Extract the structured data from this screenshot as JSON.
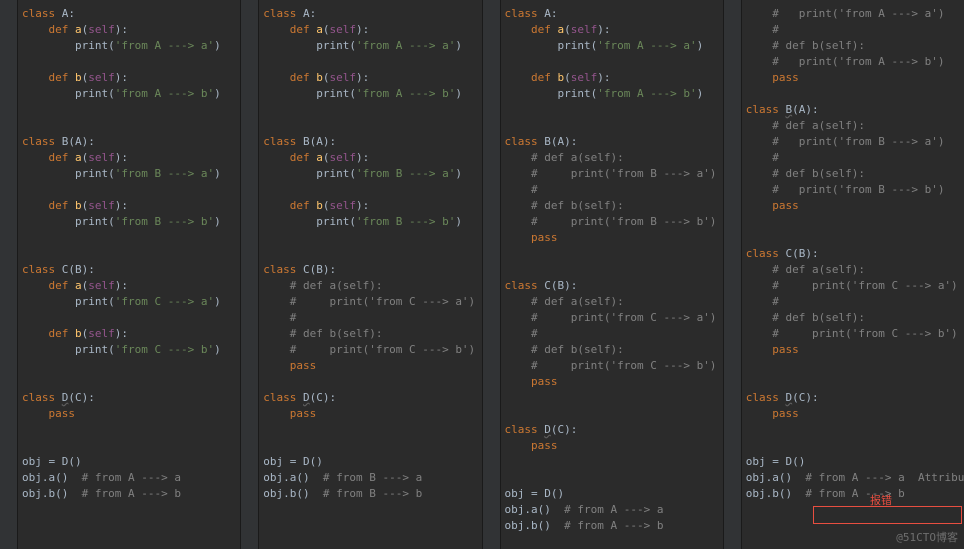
{
  "panes": {
    "p1": {
      "classA": {
        "decl": "class",
        "name": "A",
        "colon": ":",
        "a": {
          "kw": "def",
          "name": "a",
          "args": "(self):",
          "body": "print('from A ---> a')"
        },
        "b": {
          "kw": "def",
          "name": "b",
          "args": "(self):",
          "body": "print('from A ---> b')"
        }
      },
      "classB": {
        "decl": "class",
        "name": "B",
        "base": "(A)",
        "colon": ":",
        "a": {
          "kw": "def",
          "name": "a",
          "args": "(self):",
          "body": "print('from B ---> a')"
        },
        "b": {
          "kw": "def",
          "name": "b",
          "args": "(self):",
          "body": "print('from B ---> b')"
        }
      },
      "classC": {
        "decl": "class",
        "name": "C",
        "base": "(B)",
        "colon": ":",
        "a": {
          "kw": "def",
          "name": "a",
          "args": "(self):",
          "body": "print('from C ---> a')"
        },
        "b": {
          "kw": "def",
          "name": "b",
          "args": "(self):",
          "body": "print('from C ---> b')"
        }
      },
      "classD": {
        "decl": "class",
        "name": "D",
        "base": "(C)",
        "colon": ":",
        "pass": "pass"
      },
      "exec": {
        "assign": "obj = D()",
        "l1": "obj.a()",
        "c1": "# from A ---> a",
        "l2": "obj.b()",
        "c2": "# from A ---> b"
      }
    },
    "p2": {
      "classA": {
        "decl": "class",
        "name": "A",
        "colon": ":",
        "a": {
          "kw": "def",
          "name": "a",
          "args": "(self):",
          "body": "print('from A ---> a')"
        },
        "b": {
          "kw": "def",
          "name": "b",
          "args": "(self):",
          "body": "print('from A ---> b')"
        }
      },
      "classB": {
        "decl": "class",
        "name": "B",
        "base": "(A)",
        "colon": ":",
        "a": {
          "kw": "def",
          "name": "a",
          "args": "(self):",
          "body": "print('from B ---> a')"
        },
        "b": {
          "kw": "def",
          "name": "b",
          "args": "(self):",
          "body": "print('from B ---> b')"
        }
      },
      "classC": {
        "decl": "class",
        "name": "C",
        "base": "(B)",
        "colon": ":",
        "a": {
          "c": "# def a(self):",
          "b": "#     print('from C ---> a')"
        },
        "x": "#",
        "b": {
          "c": "# def b(self):",
          "b": "#     print('from C ---> b')"
        },
        "pass": "pass"
      },
      "classD": {
        "decl": "class",
        "name": "D",
        "base": "(C)",
        "colon": ":",
        "pass": "pass"
      },
      "exec": {
        "assign": "obj = D()",
        "l1": "obj.a()",
        "c1": "# from B ---> a",
        "l2": "obj.b()",
        "c2": "# from B ---> b"
      }
    },
    "p3": {
      "classA": {
        "decl": "class",
        "name": "A",
        "colon": ":",
        "a": {
          "kw": "def",
          "name": "a",
          "args": "(self):",
          "body": "print('from A ---> a')"
        },
        "b": {
          "kw": "def",
          "name": "b",
          "args": "(self):",
          "body": "print('from A ---> b')"
        }
      },
      "classB": {
        "decl": "class",
        "name": "B",
        "base": "(A)",
        "colon": ":",
        "a": {
          "c": "# def a(self):",
          "b": "#     print('from B ---> a')"
        },
        "x": "#",
        "b": {
          "c": "# def b(self):",
          "b": "#     print('from B ---> b')"
        },
        "pass": "pass"
      },
      "classC": {
        "decl": "class",
        "name": "C",
        "base": "(B)",
        "colon": ":",
        "a": {
          "c": "# def a(self):",
          "b": "#     print('from C ---> a')"
        },
        "x": "#",
        "b": {
          "c": "# def b(self):",
          "b": "#     print('from C ---> b')"
        },
        "pass": "pass"
      },
      "classD": {
        "decl": "class",
        "name": "D",
        "base": "(C)",
        "colon": ":",
        "pass": "pass"
      },
      "exec": {
        "assign": "obj = D()",
        "l1": "obj.a()",
        "c1": "# from A ---> a",
        "l2": "obj.b()",
        "c2": "# from A ---> b"
      }
    },
    "p4": {
      "classA": {
        "a": {
          "c": "#   print('from A ---> a')"
        },
        "x": "#",
        "b": {
          "c": "# def b(self):",
          "b": "#   print('from A ---> b')"
        },
        "pass": "pass"
      },
      "classB": {
        "decl": "class",
        "name": "B",
        "base": "(A)",
        "colon": ":",
        "a": {
          "c": "# def a(self):",
          "b": "#   print('from B ---> a')"
        },
        "x": "#",
        "b": {
          "c": "# def b(self):",
          "b": "#   print('from B ---> b')"
        },
        "pass": "pass"
      },
      "classC": {
        "decl": "class",
        "name": "C",
        "base": "(B)",
        "colon": ":",
        "a": {
          "c": "# def a(self):",
          "b": "#     print('from C ---> a')"
        },
        "x": "#",
        "b": {
          "c": "# def b(self):",
          "b": "#     print('from C ---> b')"
        },
        "pass": "pass"
      },
      "classD": {
        "decl": "class",
        "name": "D",
        "base": "(C)",
        "colon": ":",
        "pass": "pass"
      },
      "exec": {
        "assign": "obj = D()",
        "l1": "obj.a()",
        "c1": "# from A ---> a",
        "err": "AttributeError: 'D' object has no attribute 'a'",
        "l2": "obj.b()",
        "c2": "# from A ---> b"
      }
    }
  },
  "err_label": "报错",
  "watermark": "@51CTO博客"
}
